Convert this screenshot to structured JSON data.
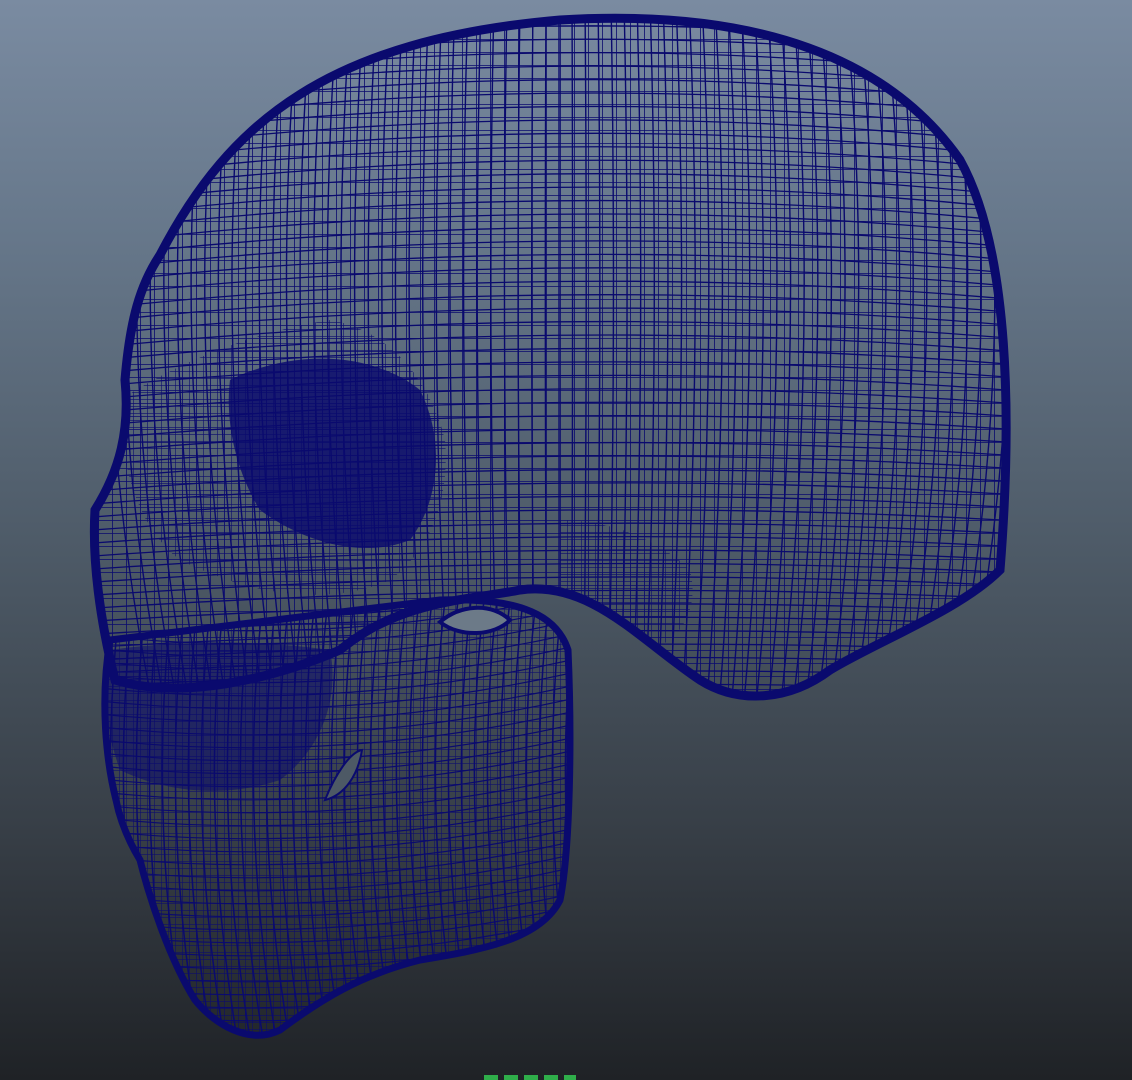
{
  "viewport": {
    "object": "skull-wireframe-mesh",
    "view": "side",
    "display_mode": "wireframe",
    "colors": {
      "background_top": "#7a8ba1",
      "background_bottom": "#1f2226",
      "wireframe": "#0a0a6e",
      "axis_marker": "#2fae4a"
    }
  }
}
